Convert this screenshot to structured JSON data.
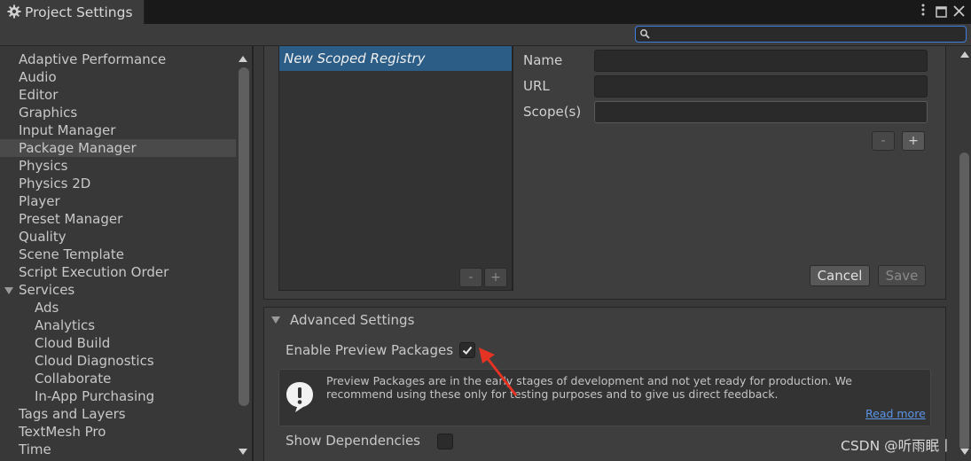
{
  "window": {
    "title": "Project Settings",
    "menu_icon": "kebab-menu-icon",
    "maximize_icon": "maximize-icon",
    "close_icon": "close-icon"
  },
  "search": {
    "value": "",
    "placeholder": ""
  },
  "sidebar": {
    "items": [
      {
        "label": "Adaptive Performance",
        "indent": 0
      },
      {
        "label": "Audio",
        "indent": 0
      },
      {
        "label": "Editor",
        "indent": 0
      },
      {
        "label": "Graphics",
        "indent": 0
      },
      {
        "label": "Input Manager",
        "indent": 0
      },
      {
        "label": "Package Manager",
        "indent": 0,
        "selected": true
      },
      {
        "label": "Physics",
        "indent": 0
      },
      {
        "label": "Physics 2D",
        "indent": 0
      },
      {
        "label": "Player",
        "indent": 0
      },
      {
        "label": "Preset Manager",
        "indent": 0
      },
      {
        "label": "Quality",
        "indent": 0
      },
      {
        "label": "Scene Template",
        "indent": 0
      },
      {
        "label": "Script Execution Order",
        "indent": 0
      },
      {
        "label": "Services",
        "indent": 0,
        "expanded": true
      },
      {
        "label": "Ads",
        "indent": 1
      },
      {
        "label": "Analytics",
        "indent": 1
      },
      {
        "label": "Cloud Build",
        "indent": 1
      },
      {
        "label": "Cloud Diagnostics",
        "indent": 1
      },
      {
        "label": "Collaborate",
        "indent": 1
      },
      {
        "label": "In-App Purchasing",
        "indent": 1
      },
      {
        "label": "Tags and Layers",
        "indent": 0
      },
      {
        "label": "TextMesh Pro",
        "indent": 0
      },
      {
        "label": "Time",
        "indent": 0
      }
    ]
  },
  "registry": {
    "selected": "New Scoped Registry",
    "name_label": "Name",
    "url_label": "URL",
    "scopes_label": "Scope(s)",
    "name_value": "",
    "url_value": "",
    "scopes_value": "",
    "minus": "-",
    "plus": "+",
    "cancel": "Cancel",
    "save": "Save"
  },
  "advanced": {
    "title": "Advanced Settings",
    "enable_preview_label": "Enable Preview Packages",
    "enable_preview_checked": true,
    "help_text": "Preview Packages are in the early stages of development and not yet ready for production. We recommend using these only for testing purposes and to give us direct feedback.",
    "read_more": "Read more",
    "show_dependencies_label": "Show Dependencies",
    "show_dependencies_checked": false
  },
  "annotation": {
    "arrow_color": "#e53323"
  },
  "watermark": "CSDN @听雨眠丨",
  "colors": {
    "selection": "#2c5d87",
    "focus": "#3d7ee0",
    "link": "#5a95e8"
  }
}
